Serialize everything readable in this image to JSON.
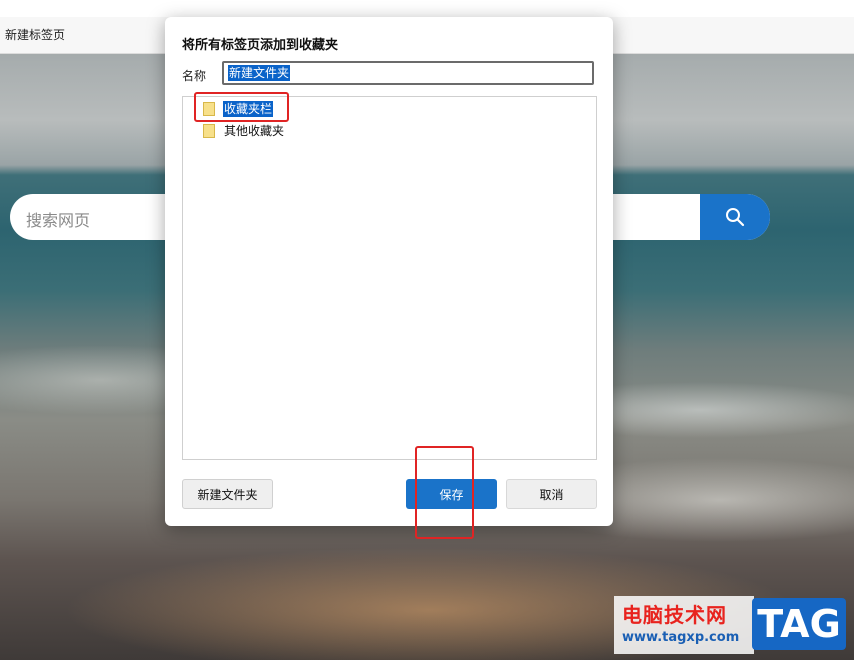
{
  "browser": {
    "tab_title": "新建标签页"
  },
  "search": {
    "placeholder": "搜索网页",
    "button_icon": "search-icon"
  },
  "dialog": {
    "title": "将所有标签页添加到收藏夹",
    "name_label": "名称",
    "name_value": "新建文件夹",
    "folders": [
      {
        "label": "收藏夹栏",
        "selected": true,
        "icon": "folder-icon"
      },
      {
        "label": "其他收藏夹",
        "selected": false,
        "icon": "folder-icon"
      }
    ],
    "buttons": {
      "new_folder": "新建文件夹",
      "save": "保存",
      "cancel": "取消"
    }
  },
  "watermark": {
    "site_name": "电脑技术网",
    "url": "www.tagxp.com",
    "logo_text": "TAG"
  },
  "colors": {
    "accent": "#1a73c9",
    "selection": "#0a63c9",
    "annotation": "#e02424"
  }
}
